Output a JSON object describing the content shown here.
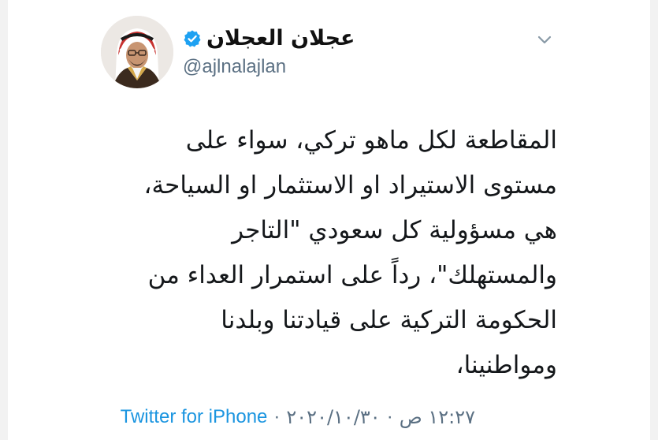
{
  "tweet": {
    "author": {
      "display_name": "عجلان العجلان",
      "handle": "@ajlnalajlan",
      "verified": true,
      "avatar_icon": "profile-photo"
    },
    "menu_icon": "chevron-down-icon",
    "text_lines": [
      "المقاطعة لكل ماهو تركي، سواء على",
      "مستوى الاستيراد او الاستثمار او السياحة،",
      "هي مسؤولية كل سعودي \"التاجر",
      "والمستهلك\"، رداً على استمرار العداء من",
      "الحكومة التركية على قيادتنا وبلدنا",
      "ومواطنينا،"
    ],
    "meta": {
      "time": "١٢:٢٧ ص",
      "separator1": "·",
      "date": "٢٠٢٠/١٠/٣٠",
      "separator2": "·",
      "source": "Twitter for iPhone"
    }
  },
  "colors": {
    "text": "#14171a",
    "secondary": "#5b7083",
    "link": "#1b95e0",
    "verified": "#1da1f2"
  }
}
